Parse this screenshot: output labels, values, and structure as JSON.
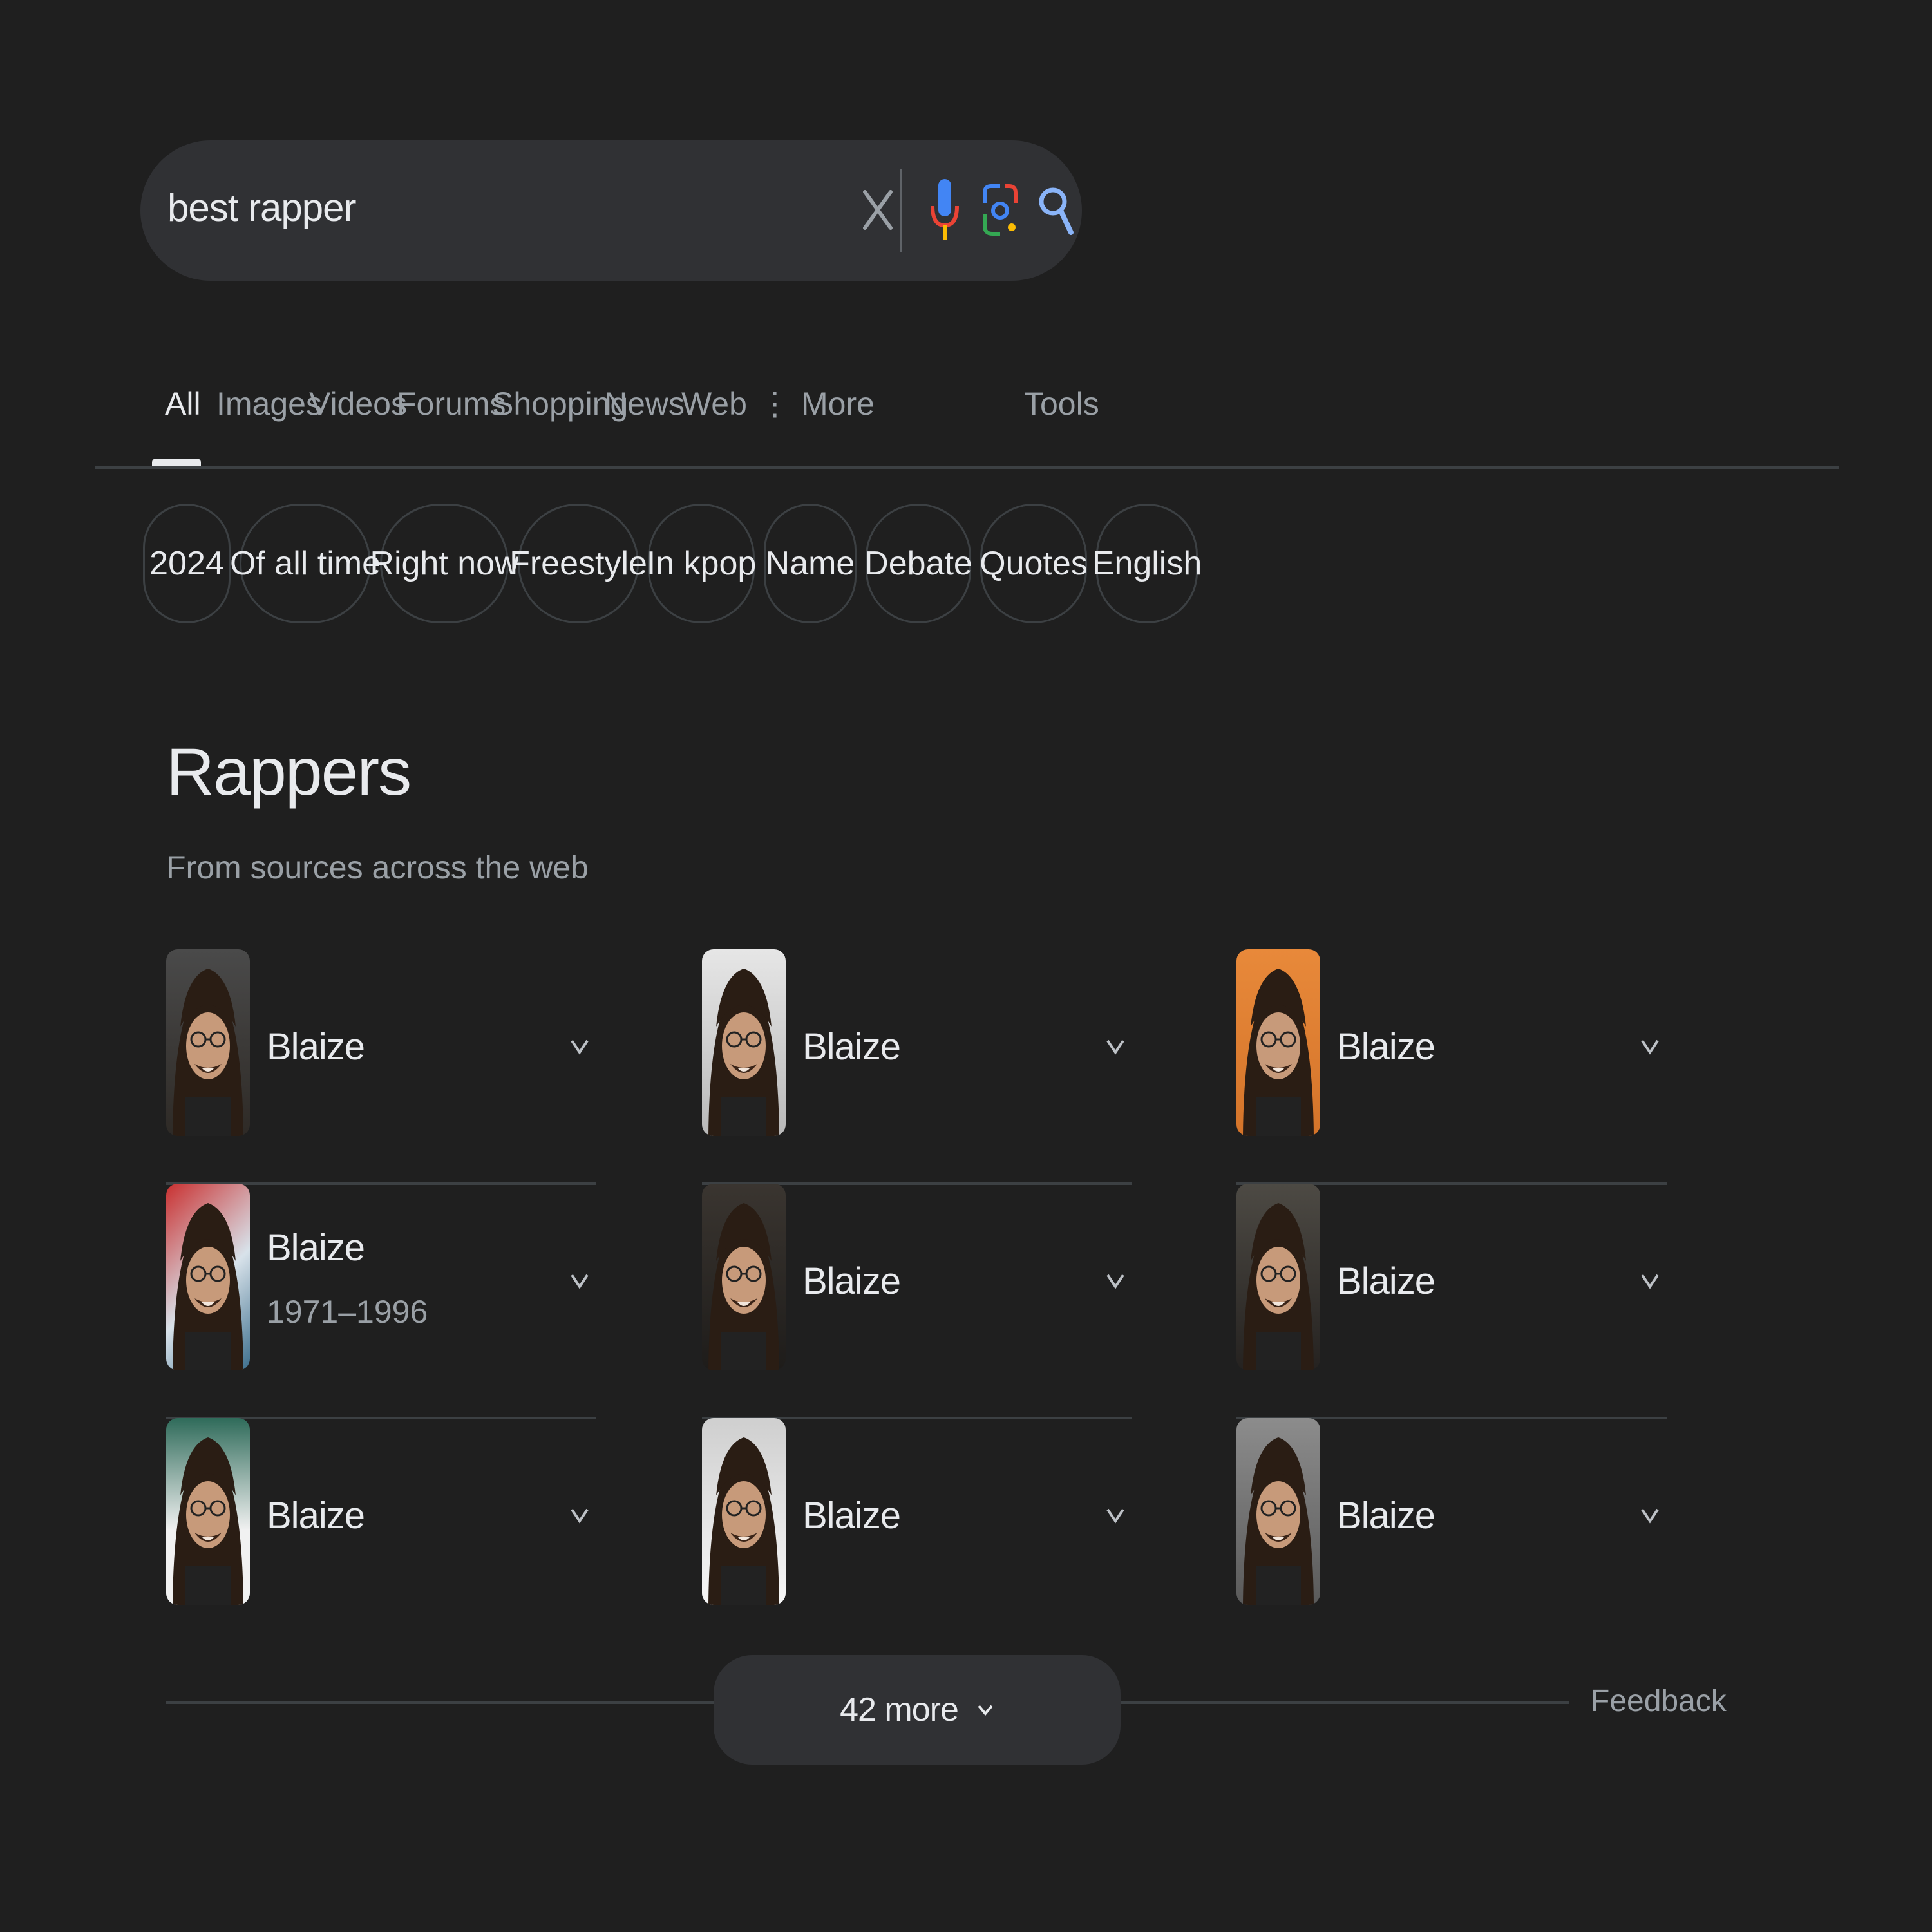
{
  "search": {
    "query": "best rapper"
  },
  "tabs": [
    {
      "label": "All"
    },
    {
      "label": "Images"
    },
    {
      "label": "Videos"
    },
    {
      "label": "Forums"
    },
    {
      "label": "Shopping"
    },
    {
      "label": "News"
    },
    {
      "label": "Web"
    },
    {
      "label": "More"
    },
    {
      "label": "Tools"
    }
  ],
  "chips": [
    "2024",
    "Of all time",
    "Right now",
    "Freestyle",
    "In kpop",
    "Name",
    "Debate",
    "Quotes",
    "English"
  ],
  "section": {
    "title": "Rappers",
    "subtitle": "From sources across the web"
  },
  "rappers": [
    {
      "name": "Blaize",
      "sub": ""
    },
    {
      "name": "Blaize",
      "sub": ""
    },
    {
      "name": "Blaize",
      "sub": ""
    },
    {
      "name": "Blaize",
      "sub": "1971–1996"
    },
    {
      "name": "Blaize",
      "sub": ""
    },
    {
      "name": "Blaize",
      "sub": ""
    },
    {
      "name": "Blaize",
      "sub": ""
    },
    {
      "name": "Blaize",
      "sub": ""
    },
    {
      "name": "Blaize",
      "sub": ""
    }
  ],
  "more_button": {
    "label": "42 more"
  },
  "feedback": {
    "label": "Feedback"
  },
  "colors": {
    "background": "#1f1f1f",
    "surface": "#303134",
    "text_primary": "#e8eaed",
    "text_secondary": "#9aa0a6",
    "mic_blue": "#4285f4",
    "mic_red": "#ea4335",
    "lens_yellow": "#fbbc04",
    "lens_green": "#34a853"
  },
  "icons": [
    "close-icon",
    "microphone-icon",
    "lens-icon",
    "search-icon",
    "more-dots-icon",
    "chevron-down-icon"
  ]
}
